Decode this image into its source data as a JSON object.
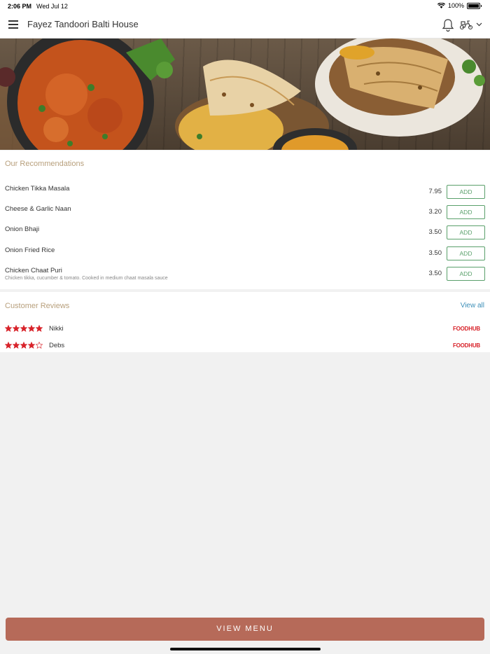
{
  "status_bar": {
    "time": "2:06 PM",
    "date": "Wed Jul 12",
    "battery": "100%"
  },
  "header": {
    "title": "Fayez Tandoori Balti House"
  },
  "recommendations": {
    "title": "Our Recommendations",
    "add_label": "ADD",
    "items": [
      {
        "name": "Chicken Tikka Masala",
        "price": "7.95",
        "description": ""
      },
      {
        "name": "Cheese & Garlic Naan",
        "price": "3.20",
        "description": ""
      },
      {
        "name": "Onion Bhaji",
        "price": "3.50",
        "description": ""
      },
      {
        "name": "Onion Fried Rice",
        "price": "3.50",
        "description": ""
      },
      {
        "name": "Chicken Chaat Puri",
        "price": "3.50",
        "description": "Chicken tikka, cucumber & tomato. Cooked in medium chaat masala sauce"
      }
    ]
  },
  "reviews": {
    "title": "Customer Reviews",
    "view_all": "View all",
    "source_label": "FOODHUB",
    "items": [
      {
        "name": "Nikki",
        "rating": 5
      },
      {
        "name": "Debs",
        "rating": 4
      }
    ]
  },
  "footer": {
    "view_menu": "VIEW MENU"
  },
  "colors": {
    "accent": "#b66a59",
    "section_title": "#b8a07d",
    "add_button": "#5aa06b",
    "star": "#d8232a",
    "link": "#3d8fb8"
  },
  "icons": {
    "menu": "hamburger-icon",
    "notifications": "bell-icon",
    "delivery": "scooter-icon",
    "dropdown": "chevron-down-icon"
  }
}
